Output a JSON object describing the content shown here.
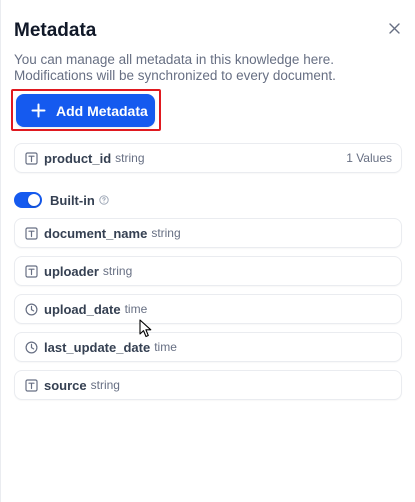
{
  "panel": {
    "title": "Metadata",
    "description": "You can manage all metadata in this knowledge here. Modifications will be synchronized to every document.",
    "add_button_label": "Add Metadata"
  },
  "custom_fields": [
    {
      "name": "product_id",
      "type": "string",
      "icon": "text-type-icon",
      "count": "1 Values"
    }
  ],
  "builtin": {
    "label": "Built-in",
    "enabled": true,
    "fields": [
      {
        "name": "document_name",
        "type": "string",
        "icon": "text-type-icon"
      },
      {
        "name": "uploader",
        "type": "string",
        "icon": "text-type-icon"
      },
      {
        "name": "upload_date",
        "type": "time",
        "icon": "clock-icon"
      },
      {
        "name": "last_update_date",
        "type": "time",
        "icon": "clock-icon"
      },
      {
        "name": "source",
        "type": "string",
        "icon": "text-type-icon"
      }
    ]
  },
  "colors": {
    "accent": "#155aef",
    "highlight": "#e0191f"
  }
}
